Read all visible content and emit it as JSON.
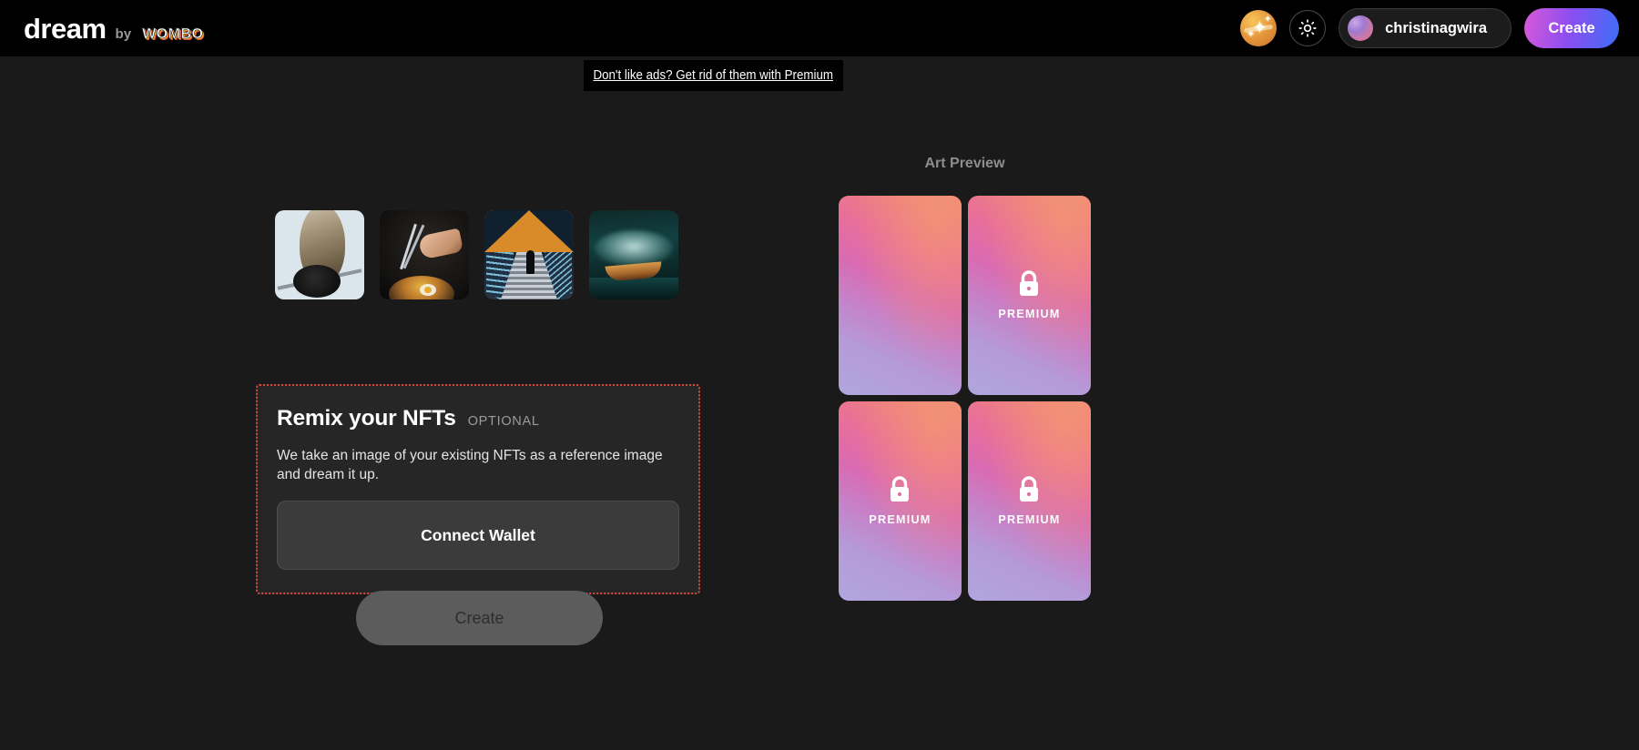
{
  "header": {
    "logo_primary": "dream",
    "logo_connector": "by",
    "logo_brand": "WOMBO",
    "coin_icon": "sparkle-coin-icon",
    "theme_icon": "sun-brightness-icon",
    "username": "christinagwira",
    "avatar_icon": "user-avatar",
    "create_label": "Create",
    "create_gradient_from": "#d959d8",
    "create_gradient_to": "#3b6ef7"
  },
  "ad_banner": {
    "text": "Don't like ads? Get rid of them with Premium"
  },
  "builder": {
    "thumbnails": [
      {
        "name": "owl-on-perch",
        "alt": "Owl perched on a rail against a pale sky"
      },
      {
        "name": "hand-with-chopsticks",
        "alt": "Hand holding chopsticks over a bowl of food"
      },
      {
        "name": "escalator-corridor",
        "alt": "Person standing on an escalator in a lit corridor"
      },
      {
        "name": "boat-in-mist",
        "alt": "Wooden boat on misty green water"
      }
    ],
    "nft_card": {
      "title": "Remix your NFTs",
      "optional_tag": "OPTIONAL",
      "description": "We take an image of your existing NFTs as a reference image and dream it up.",
      "connect_wallet_label": "Connect Wallet",
      "border_color": "#d94a3a"
    },
    "create_label": "Create"
  },
  "preview": {
    "heading": "Art Preview",
    "premium_label": "PREMIUM",
    "lock_icon": "lock-icon",
    "cards": [
      {
        "locked": false
      },
      {
        "locked": true
      },
      {
        "locked": true
      },
      {
        "locked": true
      }
    ]
  }
}
